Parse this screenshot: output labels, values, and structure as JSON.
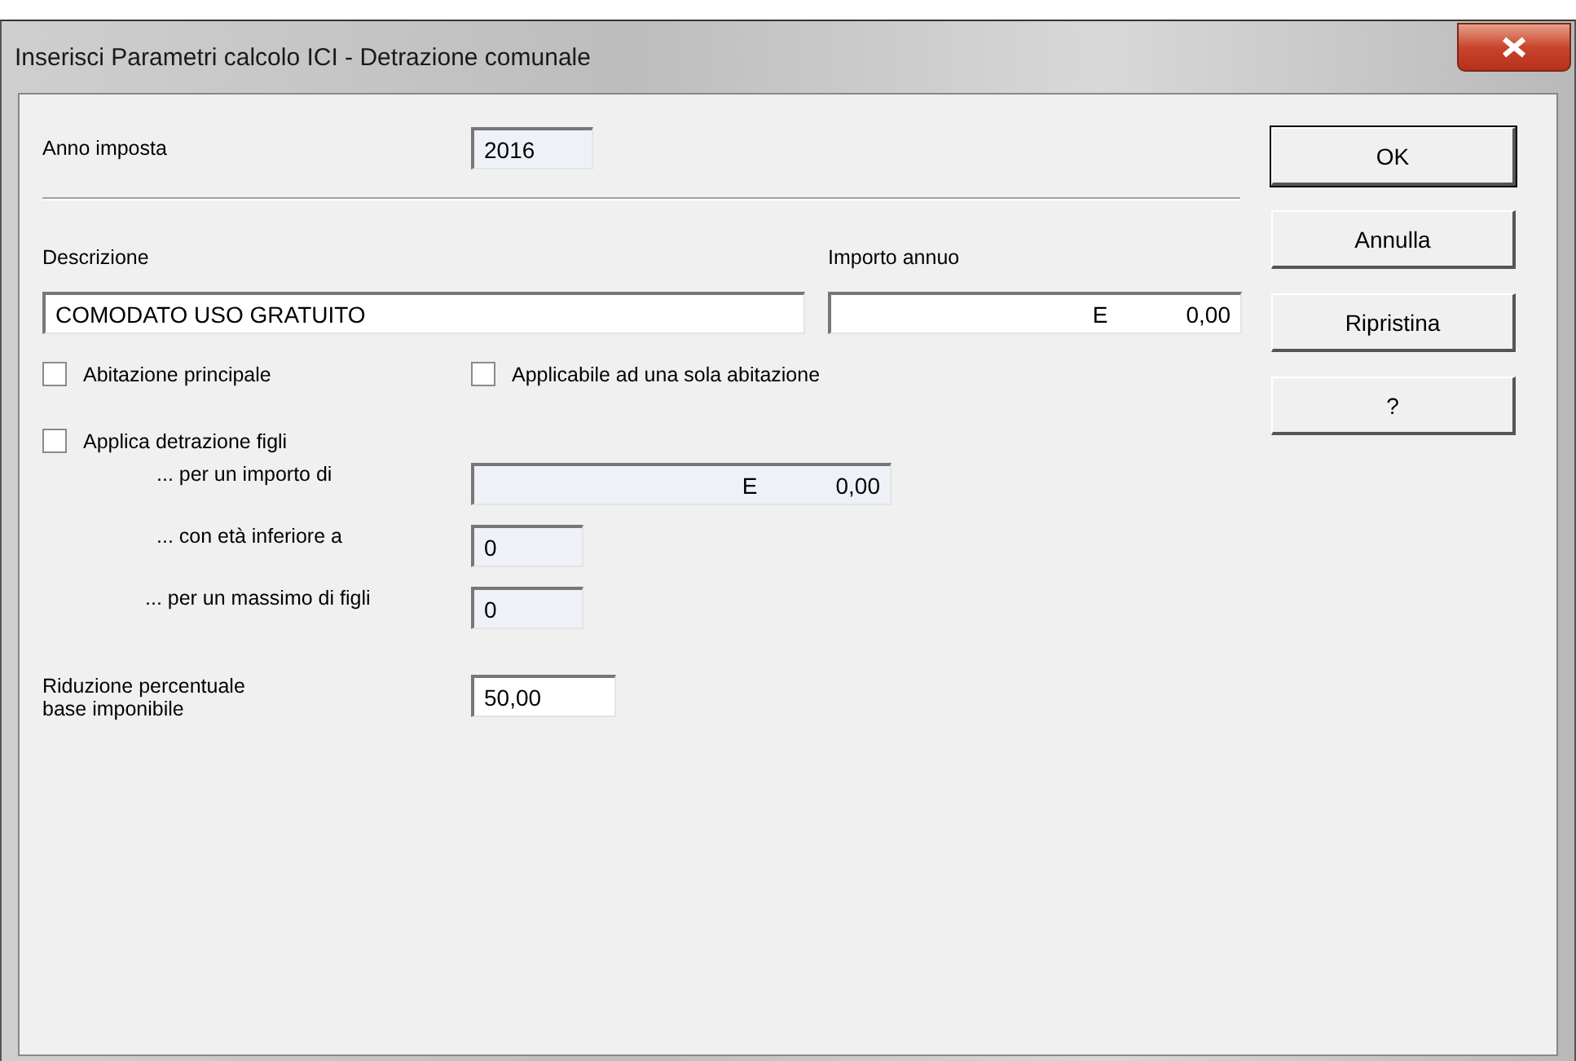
{
  "window": {
    "title": "Inserisci Parametri calcolo ICI - Detrazione comunale"
  },
  "anno_imposta": {
    "label": "Anno imposta",
    "value": "2016",
    "disabled": true
  },
  "descrizione": {
    "label": "Descrizione",
    "value": "COMODATO USO GRATUITO",
    "disabled": false
  },
  "importo_annuo": {
    "label": "Importo annuo",
    "currency": "E",
    "value": "0,00",
    "disabled": false
  },
  "checkboxes": [
    {
      "label": "Abitazione principale",
      "checked": false
    },
    {
      "label": "Applicabile ad una sola abitazione",
      "checked": false
    }
  ],
  "detrazione_figli": {
    "label": "Applica detrazione figli",
    "checked": false,
    "fields": [
      {
        "kind": "amount",
        "label": "... per un importo di",
        "currency": "E",
        "value": "0,00",
        "disabled": true
      },
      {
        "kind": "number",
        "label": "... con età inferiore a",
        "value": "0",
        "disabled": true
      },
      {
        "kind": "number",
        "label": "... per un massimo di figli",
        "value": "0",
        "disabled": true
      }
    ]
  },
  "riduzione": {
    "label_lines": [
      "Riduzione percentuale",
      "base imponibile"
    ],
    "value": "50,00",
    "disabled": false
  },
  "buttons": [
    {
      "label": "OK",
      "default": true
    },
    {
      "label": "Annulla",
      "default": false
    },
    {
      "label": "Ripristina",
      "default": false
    },
    {
      "label": "?",
      "default": false
    }
  ]
}
